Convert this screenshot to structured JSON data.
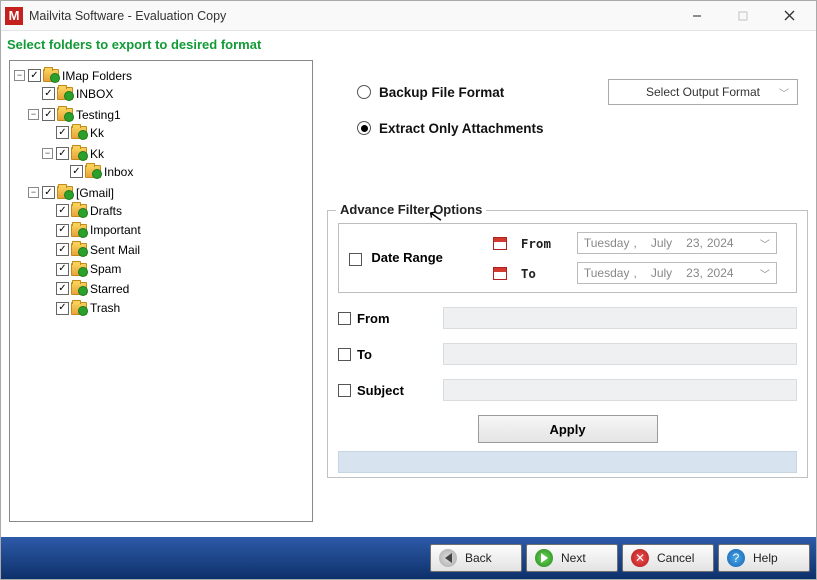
{
  "window": {
    "title": "Mailvita Software - Evaluation Copy",
    "icon_letter": "M"
  },
  "instruction": "Select folders to export to desired format",
  "tree": {
    "root_label": "IMap Folders",
    "inbox": "INBOX",
    "testing": "Testing1",
    "kk1": "Kk",
    "kk2": "Kk",
    "inbox2": "Inbox",
    "gmail": "[Gmail]",
    "drafts": "Drafts",
    "important": "Important",
    "sentmail": "Sent Mail",
    "spam": "Spam",
    "starred": "Starred",
    "trash": "Trash"
  },
  "options": {
    "backup_label": "Backup File Format",
    "extract_label": "Extract Only Attachments",
    "select_output_placeholder": "Select Output Format",
    "selected": "extract"
  },
  "filters": {
    "legend": "Advance Filter Options",
    "date_range_label": "Date Range",
    "from_lbl": "From",
    "to_lbl": "To",
    "date_from": {
      "weekday": "Tuesday",
      "month": "July",
      "day": "23,",
      "year": "2024"
    },
    "date_to": {
      "weekday": "Tuesday",
      "month": "July",
      "day": "23,",
      "year": "2024"
    },
    "row_from": "From",
    "row_to": "To",
    "row_subject": "Subject",
    "apply": "Apply"
  },
  "footer": {
    "back": "Back",
    "next": "Next",
    "cancel": "Cancel",
    "help": "Help"
  }
}
